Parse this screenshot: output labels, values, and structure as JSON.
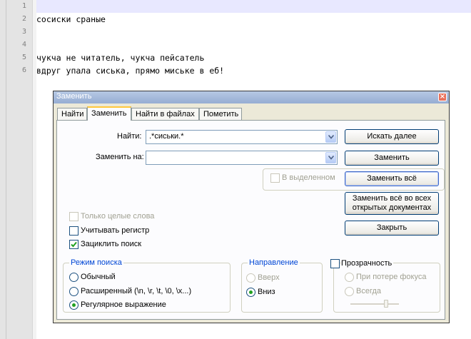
{
  "editor": {
    "lines": [
      {
        "num": "1",
        "text": ""
      },
      {
        "num": "2",
        "text": "сосиски сраные"
      },
      {
        "num": "3",
        "text": ""
      },
      {
        "num": "4",
        "text": ""
      },
      {
        "num": "5",
        "text": "чукча не читатель, чукча пейсатель"
      },
      {
        "num": "6",
        "text": "вдруг упала сиська, прямо миське в еб!"
      }
    ]
  },
  "dialog": {
    "title": "Заменить",
    "close_label": "×",
    "tabs": [
      {
        "label": "Найти"
      },
      {
        "label": "Заменить"
      },
      {
        "label": "Найти в файлах"
      },
      {
        "label": "Пометить"
      }
    ],
    "find_label": "Найти:",
    "find_value": ".*сиськи.*",
    "replace_label": "Заменить на:",
    "replace_value": "",
    "in_selection_label": "В выделенном",
    "buttons": {
      "find_next": "Искать далее",
      "replace": "Заменить",
      "replace_all": "Заменить всё",
      "replace_all_docs_line1": "Заменить всё во всех",
      "replace_all_docs_line2": "открытых документах",
      "close": "Закрыть"
    },
    "options": {
      "whole_word": "Только целые слова",
      "match_case": "Учитывать регистр",
      "wrap_around": "Зациклить поиск"
    },
    "search_mode": {
      "legend": "Режим поиска",
      "normal": "Обычный",
      "extended": "Расширенный (\\n, \\r, \\t, \\0, \\x...)",
      "regex": "Регулярное выражение"
    },
    "direction": {
      "legend": "Направление",
      "up": "Вверх",
      "down": "Вниз"
    },
    "transparency": {
      "legend": "Прозрачность",
      "on_lose_focus": "При потере фокуса",
      "always": "Всегда"
    }
  }
}
